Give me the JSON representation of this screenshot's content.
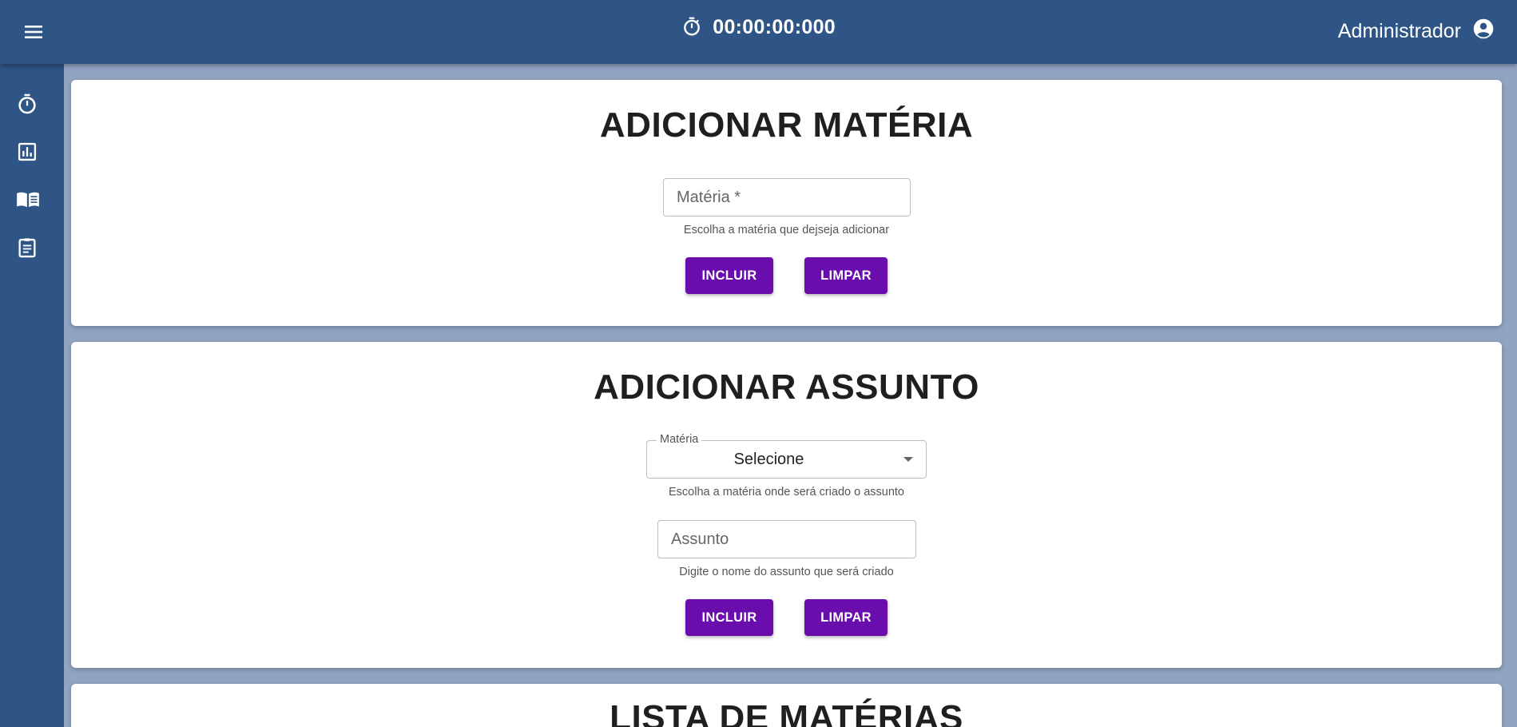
{
  "header": {
    "timer": "00:00:00:000",
    "user_name": "Administrador"
  },
  "icons": {
    "menu": "menu-icon",
    "timer": "timer-icon",
    "account": "account-circle-icon",
    "sidebar": [
      "timer-icon",
      "bar-chart-icon",
      "book-open-icon",
      "clipboard-list-icon"
    ]
  },
  "add_subject": {
    "title": "ADICIONAR MATÉRIA",
    "input_placeholder": "Matéria *",
    "helper": "Escolha a matéria que dejseja adicionar",
    "include_label": "INCLUIR",
    "clear_label": "LIMPAR"
  },
  "add_topic": {
    "title": "ADICIONAR ASSUNTO",
    "select_label": "Matéria",
    "select_value": "Selecione",
    "select_helper": "Escolha a matéria onde será criado o assunto",
    "input_placeholder": "Assunto",
    "input_helper": "Digite o nome do assunto que será criado",
    "include_label": "INCLUIR",
    "clear_label": "LIMPAR"
  },
  "subject_list": {
    "title": "LISTA DE MATÉRIAS"
  },
  "colors": {
    "header": "#2e5586",
    "background": "#91a5c2",
    "button": "#6a0dad"
  }
}
